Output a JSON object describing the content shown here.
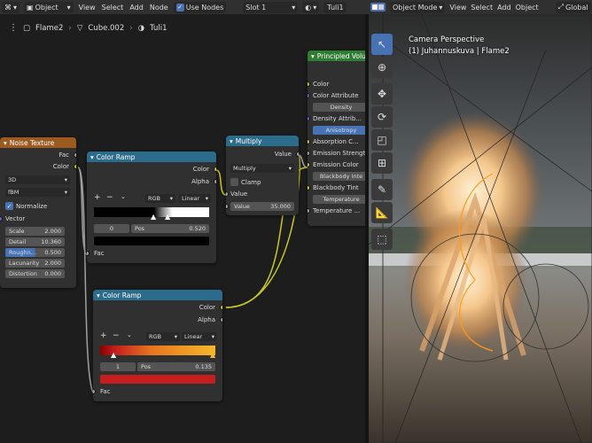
{
  "topbar": {
    "editor_icon": "node-editor-icon",
    "object_mode": "Object",
    "menus": [
      "View",
      "Select",
      "Add",
      "Node"
    ],
    "use_nodes": "Use Nodes",
    "slot": "Slot 1",
    "material": "Tuli1"
  },
  "breadcrumb": {
    "items": [
      "Flame2",
      "Cube.002",
      "Tuli1"
    ]
  },
  "viewport_header": {
    "mode": "Object Mode",
    "menus": [
      "View",
      "Select",
      "Add",
      "Object"
    ],
    "transform": "Global"
  },
  "viewport": {
    "title": "Camera Perspective",
    "subtitle": "(1) Juhannuskuva | Flame2"
  },
  "nodes": {
    "noise": {
      "title": "Noise Texture",
      "out_fac": "Fac",
      "out_color": "Color",
      "dim": "3D",
      "type": "fBM",
      "normalize": "Normalize",
      "vector": "Vector",
      "fields": [
        {
          "label": "Scale",
          "value": "2.000"
        },
        {
          "label": "Detail",
          "value": "10.360"
        },
        {
          "label": "Roughn...",
          "value": "0.500"
        },
        {
          "label": "Lacunarity",
          "value": "2.000"
        },
        {
          "label": "Distortion",
          "value": "0.000"
        }
      ]
    },
    "ramp1": {
      "title": "Color Ramp",
      "out_color": "Color",
      "out_alpha": "Alpha",
      "mode": "RGB",
      "interp": "Linear",
      "index": "0",
      "pos_label": "Pos",
      "pos": "0.520",
      "in_fac": "Fac"
    },
    "multiply": {
      "title": "Multiply",
      "out_value": "Value",
      "op": "Multiply",
      "clamp": "Clamp",
      "in_value": "Value",
      "value_label": "Value",
      "value": "35.000"
    },
    "ramp2": {
      "title": "Color Ramp",
      "out_color": "Color",
      "out_alpha": "Alpha",
      "mode": "RGB",
      "interp": "Linear",
      "index": "1",
      "pos_label": "Pos",
      "pos": "0.135",
      "in_fac": "Fac"
    },
    "principled": {
      "title": "Principled Volu",
      "inputs": [
        "Color",
        "Color Attribute",
        "Density",
        "Density Attrib...",
        "Anisotropy",
        "Absorption C...",
        "Emission Strength",
        "Emission Color",
        "Blackbody Inte",
        "Blackbody Tint",
        "Temperature",
        "Temperature ..."
      ]
    }
  },
  "colors": {
    "accent": "#4772b3",
    "shader_header": "#2e7d32",
    "converter_header": "#2b6b8c",
    "texture_header": "#9c5a1e"
  }
}
